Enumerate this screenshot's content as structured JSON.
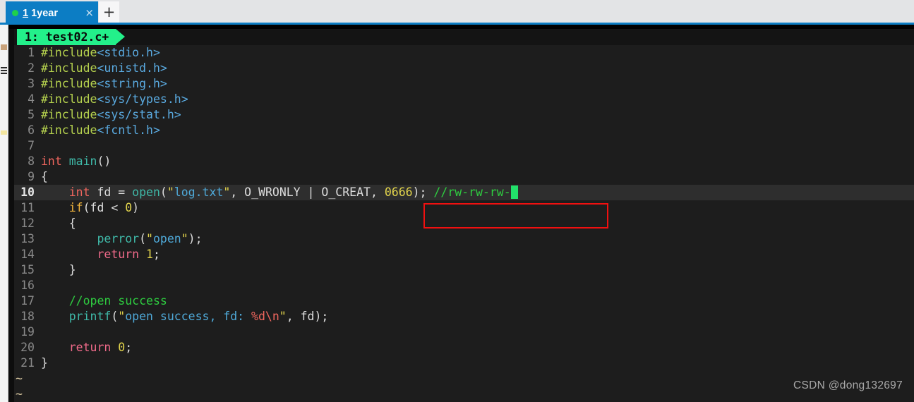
{
  "browser": {
    "tab": {
      "status_dot": "green-dot-icon",
      "index": "1",
      "title": "1year",
      "close_label": "×"
    },
    "new_tab_label": "+"
  },
  "sidebar": {
    "icons": [
      "bookmark-icon",
      "menu-lines-icon",
      "highlight-icon"
    ]
  },
  "editor": {
    "tabline": {
      "label": "1: test02.c+"
    },
    "filename": "test02.c",
    "modified": true,
    "cursor_line": 10,
    "tilde_rows": [
      "~",
      "~"
    ],
    "lines": [
      {
        "n": "1",
        "tokens": [
          {
            "t": "#include",
            "c": "t-pre"
          },
          {
            "t": "<stdio.h>",
            "c": "t-hdr"
          }
        ]
      },
      {
        "n": "2",
        "tokens": [
          {
            "t": "#include",
            "c": "t-pre"
          },
          {
            "t": "<unistd.h>",
            "c": "t-hdr"
          }
        ]
      },
      {
        "n": "3",
        "tokens": [
          {
            "t": "#include",
            "c": "t-pre"
          },
          {
            "t": "<string.h>",
            "c": "t-hdr"
          }
        ]
      },
      {
        "n": "4",
        "tokens": [
          {
            "t": "#include",
            "c": "t-pre"
          },
          {
            "t": "<sys/types.h>",
            "c": "t-hdr"
          }
        ]
      },
      {
        "n": "5",
        "tokens": [
          {
            "t": "#include",
            "c": "t-pre"
          },
          {
            "t": "<sys/stat.h>",
            "c": "t-hdr"
          }
        ]
      },
      {
        "n": "6",
        "tokens": [
          {
            "t": "#include",
            "c": "t-pre"
          },
          {
            "t": "<fcntl.h>",
            "c": "t-hdr"
          }
        ]
      },
      {
        "n": "7",
        "tokens": []
      },
      {
        "n": "8",
        "tokens": [
          {
            "t": "int ",
            "c": "t-type"
          },
          {
            "t": "main",
            "c": "t-fn"
          },
          {
            "t": "()",
            "c": "t-punct"
          }
        ]
      },
      {
        "n": "9",
        "tokens": [
          {
            "t": "{",
            "c": "t-brace"
          }
        ]
      },
      {
        "n": "10",
        "current": true,
        "tokens": [
          {
            "t": "    ",
            "c": "t-plain"
          },
          {
            "t": "int",
            "c": "t-type"
          },
          {
            "t": " fd = ",
            "c": "t-plain"
          },
          {
            "t": "open",
            "c": "t-fn"
          },
          {
            "t": "(",
            "c": "t-punct"
          },
          {
            "t": "\"",
            "c": "t-quote"
          },
          {
            "t": "log.txt",
            "c": "t-str"
          },
          {
            "t": "\"",
            "c": "t-quote"
          },
          {
            "t": ", O_WRONLY | O_CREAT, ",
            "c": "t-plain"
          },
          {
            "t": "0666",
            "c": "t-num"
          },
          {
            "t": "); ",
            "c": "t-punct"
          },
          {
            "t": "//rw-rw-rw-",
            "c": "t-cmt"
          },
          {
            "t": "CURSOR",
            "c": "cursor"
          }
        ]
      },
      {
        "n": "11",
        "tokens": [
          {
            "t": "    ",
            "c": "t-plain"
          },
          {
            "t": "if",
            "c": "t-kw2"
          },
          {
            "t": "(fd < ",
            "c": "t-plain"
          },
          {
            "t": "0",
            "c": "t-num"
          },
          {
            "t": ")",
            "c": "t-punct"
          }
        ]
      },
      {
        "n": "12",
        "tokens": [
          {
            "t": "    {",
            "c": "t-brace"
          }
        ]
      },
      {
        "n": "13",
        "tokens": [
          {
            "t": "        ",
            "c": "t-plain"
          },
          {
            "t": "perror",
            "c": "t-fn"
          },
          {
            "t": "(",
            "c": "t-punct"
          },
          {
            "t": "\"",
            "c": "t-quote"
          },
          {
            "t": "open",
            "c": "t-str"
          },
          {
            "t": "\"",
            "c": "t-quote"
          },
          {
            "t": ");",
            "c": "t-punct"
          }
        ]
      },
      {
        "n": "14",
        "tokens": [
          {
            "t": "        ",
            "c": "t-plain"
          },
          {
            "t": "return",
            "c": "t-kw"
          },
          {
            "t": " ",
            "c": "t-plain"
          },
          {
            "t": "1",
            "c": "t-num"
          },
          {
            "t": ";",
            "c": "t-punct"
          }
        ]
      },
      {
        "n": "15",
        "tokens": [
          {
            "t": "    }",
            "c": "t-brace"
          }
        ]
      },
      {
        "n": "16",
        "tokens": []
      },
      {
        "n": "17",
        "tokens": [
          {
            "t": "    ",
            "c": "t-plain"
          },
          {
            "t": "//open success",
            "c": "t-cmt"
          }
        ]
      },
      {
        "n": "18",
        "tokens": [
          {
            "t": "    ",
            "c": "t-plain"
          },
          {
            "t": "printf",
            "c": "t-fn"
          },
          {
            "t": "(",
            "c": "t-punct"
          },
          {
            "t": "\"",
            "c": "t-quote"
          },
          {
            "t": "open success, fd: ",
            "c": "t-str"
          },
          {
            "t": "%d\\n",
            "c": "t-fmt"
          },
          {
            "t": "\"",
            "c": "t-quote"
          },
          {
            "t": ", fd);",
            "c": "t-plain"
          }
        ]
      },
      {
        "n": "19",
        "tokens": []
      },
      {
        "n": "20",
        "tokens": [
          {
            "t": "    ",
            "c": "t-plain"
          },
          {
            "t": "return",
            "c": "t-kw"
          },
          {
            "t": " ",
            "c": "t-plain"
          },
          {
            "t": "0",
            "c": "t-num"
          },
          {
            "t": ";",
            "c": "t-punct"
          }
        ]
      },
      {
        "n": "21",
        "tokens": [
          {
            "t": "}",
            "c": "t-brace"
          }
        ]
      }
    ]
  },
  "annotation": {
    "box_color": "#f01010",
    "highlighted_text": "0666); //rw-rw-rw-"
  },
  "watermark": "CSDN @dong132697",
  "colors": {
    "browser_tab_bg": "#0c7dc4",
    "strip_bg": "#e3e4e6",
    "terminal_bg": "#1d1d1d",
    "vim_tab_bg": "#23f08a",
    "cursor": "#22e06a",
    "current_line_bg": "#2e2e2e"
  }
}
